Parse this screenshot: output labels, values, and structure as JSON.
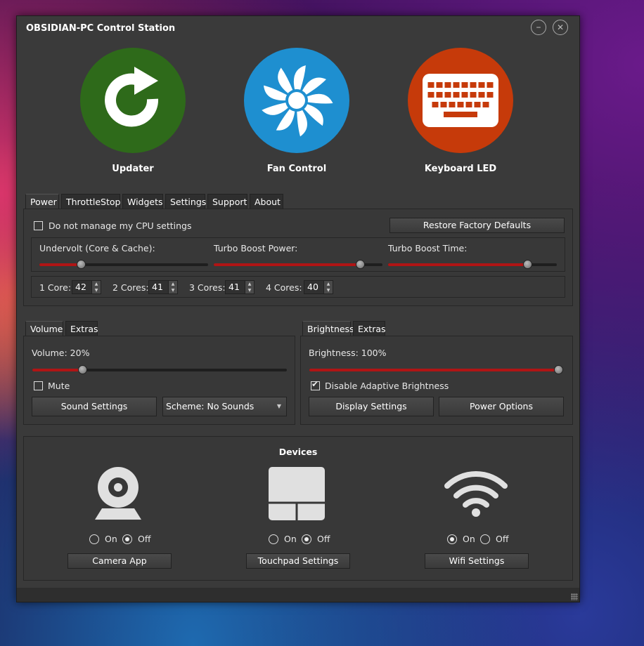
{
  "window": {
    "title": "OBSIDIAN-PC Control Station",
    "minimize": "–",
    "close": "✕"
  },
  "tiles": [
    {
      "label": "Updater",
      "color": "#2e6a1a",
      "icon": "refresh-icon"
    },
    {
      "label": "Fan Control",
      "color": "#1e8fd0",
      "icon": "fan-icon"
    },
    {
      "label": "Keyboard LED",
      "color": "#c63a0a",
      "icon": "keyboard-icon"
    }
  ],
  "power_tabs": [
    "Power",
    "ThrottleStop",
    "Widgets",
    "Settings",
    "Support",
    "About"
  ],
  "power": {
    "manage_cpu_label": "Do not manage my CPU settings",
    "manage_cpu_checked": false,
    "restore_button": "Restore Factory Defaults",
    "sliders": [
      {
        "label": "Undervolt (Core & Cache):",
        "value": 0.25
      },
      {
        "label": "Turbo Boost Power:",
        "value": 0.87
      },
      {
        "label": "Turbo Boost Time:",
        "value": 0.83
      }
    ],
    "cores": [
      {
        "label": "1 Core:",
        "value": "42"
      },
      {
        "label": "2 Cores:",
        "value": "41"
      },
      {
        "label": "3 Cores:",
        "value": "41"
      },
      {
        "label": "4  Cores:",
        "value": "40"
      }
    ]
  },
  "volume_tabs": [
    "Volume",
    "Extras"
  ],
  "volume": {
    "label": "Volume: 20%",
    "value": 0.2,
    "mute_label": "Mute",
    "mute_checked": false,
    "sound_settings": "Sound Settings",
    "scheme": "Scheme: No Sounds"
  },
  "brightness_tabs": [
    "Brightness",
    "Extras"
  ],
  "brightness": {
    "label": "Brightness: 100%",
    "value": 1.0,
    "adaptive_label": "Disable Adaptive Brightness",
    "adaptive_checked": true,
    "display_settings": "Display Settings",
    "power_options": "Power Options"
  },
  "devices": {
    "title": "Devices",
    "on_label": "On",
    "off_label": "Off",
    "items": [
      {
        "icon": "webcam-icon",
        "state": "off",
        "button": "Camera App"
      },
      {
        "icon": "touchpad-icon",
        "state": "off",
        "button": "Touchpad Settings"
      },
      {
        "icon": "wifi-icon",
        "state": "on",
        "button": "Wifi Settings"
      }
    ]
  },
  "colors": {
    "accent": "#b01515",
    "window_bg": "#3a3a3a"
  }
}
